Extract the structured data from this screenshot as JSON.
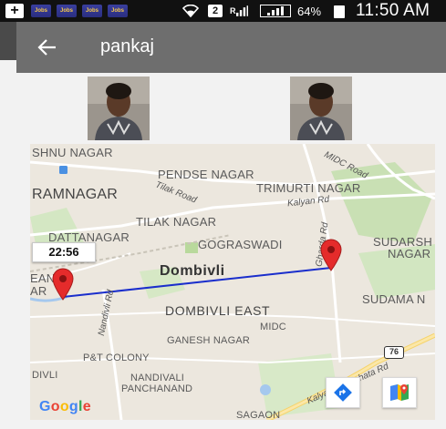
{
  "status_bar": {
    "notif_label": "Jobs",
    "sim_badge": "2",
    "signal_prefix": "R",
    "battery": "64%",
    "time": "11:50 AM"
  },
  "app_bar": {
    "title": "pankaj"
  },
  "map": {
    "places": [
      {
        "id": "shivnagar",
        "text": "SHNU NAGAR"
      },
      {
        "id": "pendse",
        "text": "PENDSE NAGAR"
      },
      {
        "id": "ramnagar",
        "text": "RAMNAGAR"
      },
      {
        "id": "trimurti",
        "text": "TRIMURTI NAGAR"
      },
      {
        "id": "tilak",
        "text": "TILAK NAGAR"
      },
      {
        "id": "dattanagar",
        "text": "DATTANAGAR"
      },
      {
        "id": "gograswadi",
        "text": "GOGRASWADI"
      },
      {
        "id": "sudarsh",
        "text": "SUDARSH"
      },
      {
        "id": "nagar",
        "text": "NAGAR"
      },
      {
        "id": "dombivli",
        "text": "Dombivli"
      },
      {
        "id": "dombivli-east",
        "text": "DOMBIVLI EAST"
      },
      {
        "id": "sudama",
        "text": "SUDAMA N"
      },
      {
        "id": "midc",
        "text": "MIDC"
      },
      {
        "id": "ganesh",
        "text": "GANESH NAGAR"
      },
      {
        "id": "pt-colony",
        "text": "P&T COLONY"
      },
      {
        "id": "divli",
        "text": "DIVLI"
      },
      {
        "id": "nandivali",
        "text": "NANDIVALI"
      },
      {
        "id": "panchanand",
        "text": "PANCHANAND"
      },
      {
        "id": "sagaon",
        "text": "SAGAON"
      },
      {
        "id": "ean",
        "text": "EAN"
      },
      {
        "id": "ar",
        "text": "AR"
      }
    ],
    "roads": [
      {
        "id": "midc-road",
        "text": "MIDC Road"
      },
      {
        "id": "tilak-road",
        "text": "Tilak Road"
      },
      {
        "id": "kalyan-road",
        "text": "Kalyan Rd"
      },
      {
        "id": "ghardana-rd",
        "text": "Gharda Rd"
      },
      {
        "id": "nandivli-rd",
        "text": "Nandivli Rd"
      },
      {
        "id": "shil-rd",
        "text": "Kalyan - Shilphata Rd"
      }
    ],
    "highway_shield": "76",
    "elapsed_time": "22:56",
    "google_logo": [
      "G",
      "o",
      "o",
      "g",
      "l",
      "e"
    ],
    "colors": {
      "route": "#1a2ecc",
      "pin": "#e52b2b",
      "water": "#a5c8ee",
      "park": "#c5dfb0"
    }
  }
}
